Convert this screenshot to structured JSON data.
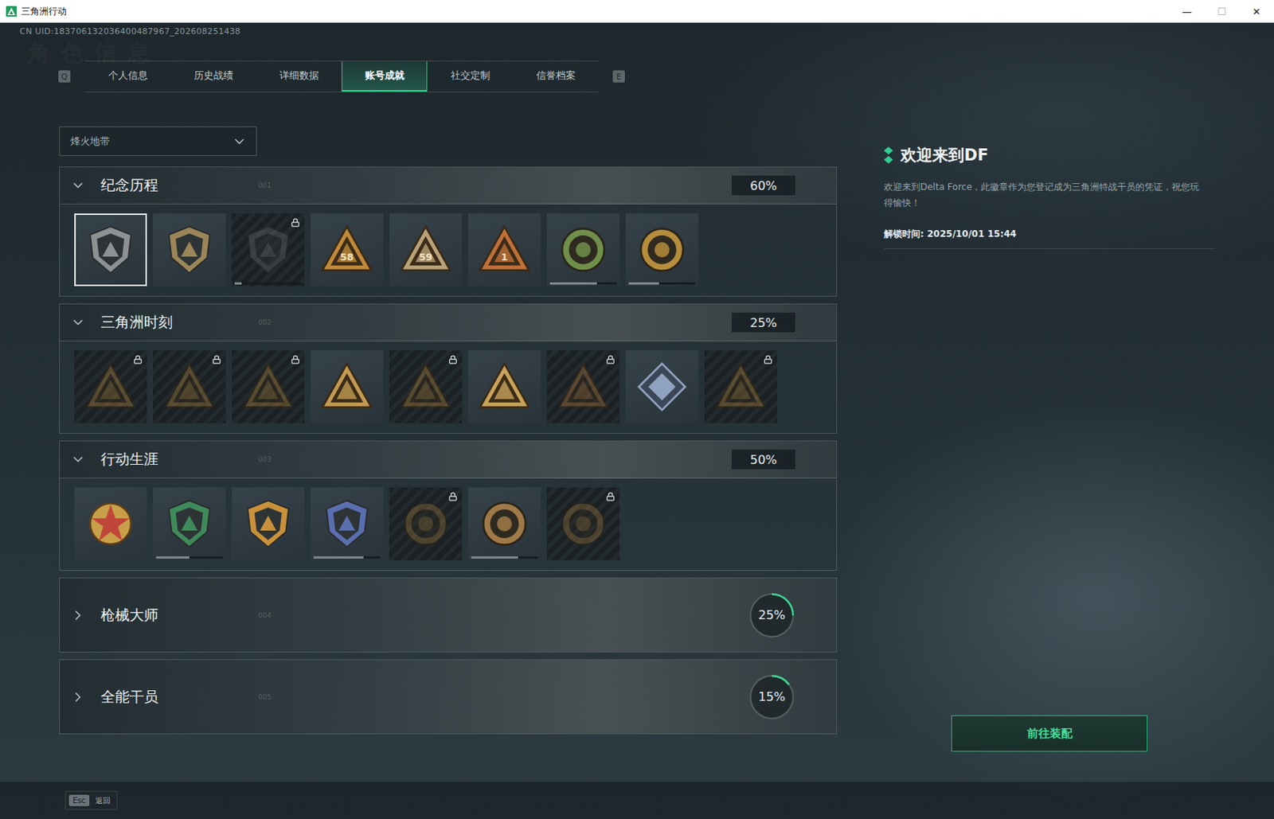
{
  "window": {
    "title": "三角洲行动",
    "controls": [
      "—",
      "☐",
      "✕"
    ]
  },
  "uid": "CN UID:183706132036400487967_202608251438",
  "watermark": "角色信息",
  "tab_keys": {
    "prev": "Q",
    "next": "E"
  },
  "tabs": [
    {
      "label": "个人信息",
      "selected": false
    },
    {
      "label": "历史战绩",
      "selected": false
    },
    {
      "label": "详细数据",
      "selected": false
    },
    {
      "label": "账号成就",
      "selected": true
    },
    {
      "label": "社交定制",
      "selected": false
    },
    {
      "label": "信誉档案",
      "selected": false
    }
  ],
  "mode_select": {
    "value": "烽火地带",
    "expanded": false
  },
  "sections": [
    {
      "title": "纪念历程",
      "index": "001",
      "percent": "60%",
      "expanded": true,
      "badges": [
        {
          "kind": "shield",
          "color": "#8c9294",
          "mark": "",
          "locked": false,
          "selected": true
        },
        {
          "kind": "shield",
          "color": "#9a8658",
          "mark": "",
          "locked": false,
          "selected": false
        },
        {
          "kind": "shield",
          "color": "#5a6266",
          "mark": "",
          "locked": true,
          "selected": false,
          "level": 0.1
        },
        {
          "kind": "triangle",
          "color": "#c08a3a",
          "mark": "58",
          "locked": false,
          "selected": false
        },
        {
          "kind": "triangle",
          "color": "#b9a27a",
          "mark": "59",
          "locked": false,
          "selected": false
        },
        {
          "kind": "triangle",
          "color": "#c0703a",
          "mark": "1",
          "locked": false,
          "selected": false
        },
        {
          "kind": "round",
          "color": "#6f8f4a",
          "mark": "",
          "locked": false,
          "selected": false,
          "level": 0.7
        },
        {
          "kind": "round",
          "color": "#b58d3c",
          "mark": "",
          "locked": false,
          "selected": false,
          "level": 0.45
        }
      ]
    },
    {
      "title": "三角洲时刻",
      "index": "002",
      "percent": "25%",
      "expanded": true,
      "badges": [
        {
          "kind": "triangle",
          "color": "#a07a3c",
          "mark": "",
          "locked": true,
          "selected": false
        },
        {
          "kind": "triangle",
          "color": "#a07a3c",
          "mark": "",
          "locked": true,
          "selected": false
        },
        {
          "kind": "triangle",
          "color": "#a07a3c",
          "mark": "",
          "locked": true,
          "selected": false
        },
        {
          "kind": "triangle",
          "color": "#c29a52",
          "mark": "",
          "locked": false,
          "selected": false
        },
        {
          "kind": "triangle",
          "color": "#a07a3c",
          "mark": "",
          "locked": true,
          "selected": false
        },
        {
          "kind": "triangle",
          "color": "#c7a35a",
          "mark": "",
          "locked": false,
          "selected": false
        },
        {
          "kind": "triangle",
          "color": "#a0703c",
          "mark": "",
          "locked": true,
          "selected": false
        },
        {
          "kind": "diamond",
          "color": "#8fa3c0",
          "mark": "",
          "locked": false,
          "selected": false
        },
        {
          "kind": "triangle",
          "color": "#a07a3c",
          "mark": "",
          "locked": true,
          "selected": false
        }
      ]
    },
    {
      "title": "行动生涯",
      "index": "003",
      "percent": "50%",
      "expanded": true,
      "badges": [
        {
          "kind": "star",
          "color": "#c0463a",
          "mark": "",
          "locked": false,
          "selected": false
        },
        {
          "kind": "shield",
          "color": "#3f8a5a",
          "mark": "",
          "locked": false,
          "selected": false,
          "level": 0.5
        },
        {
          "kind": "shield",
          "color": "#c8913a",
          "mark": "",
          "locked": false,
          "selected": false
        },
        {
          "kind": "shield",
          "color": "#5a6fb0",
          "mark": "",
          "locked": false,
          "selected": false,
          "level": 0.75
        },
        {
          "kind": "round",
          "color": "#8a6a3a",
          "mark": "",
          "locked": true,
          "selected": false
        },
        {
          "kind": "round",
          "color": "#a07a48",
          "mark": "",
          "locked": false,
          "selected": false,
          "level": 0.7
        },
        {
          "kind": "round",
          "color": "#8a6a3a",
          "mark": "",
          "locked": true,
          "selected": false
        }
      ]
    },
    {
      "title": "枪械大师",
      "index": "004",
      "percent": "25%",
      "level": 0.25,
      "expanded": false,
      "badges": []
    },
    {
      "title": "全能干员",
      "index": "005",
      "percent": "15%",
      "level": 0.15,
      "expanded": false,
      "badges": []
    }
  ],
  "detail": {
    "title": "欢迎来到DF",
    "description": "欢迎来到Delta Force，此徽章作为您登记成为三角洲特战干员的凭证，祝您玩得愉快！",
    "unlock_time": "解锁时间: 2025/10/01 15:44"
  },
  "equip_button": "前往装配",
  "footer": {
    "key": "Esc",
    "label": "返回"
  }
}
